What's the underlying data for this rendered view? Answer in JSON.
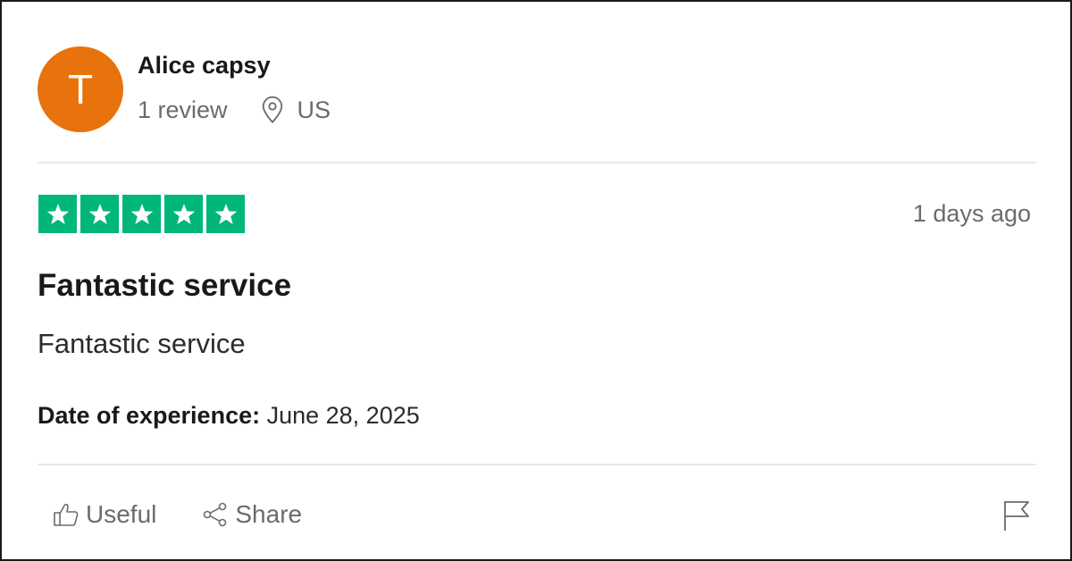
{
  "reviewer": {
    "avatar_letter": "T",
    "avatar_color": "#e8720c",
    "name": "Alice capsy",
    "review_count": "1 review",
    "location_icon": "location-pin-icon",
    "country": "US"
  },
  "review": {
    "rating": 5,
    "rating_max": 5,
    "star_color": "#00b67a",
    "time_ago": "1 days ago",
    "title": "Fantastic service",
    "body": "Fantastic service",
    "experience_label": "Date of experience:",
    "experience_date": " June 28, 2025"
  },
  "actions": {
    "useful_label": "Useful",
    "useful_icon": "thumbs-up-icon",
    "share_label": "Share",
    "share_icon": "share-icon",
    "report_icon": "flag-icon"
  }
}
